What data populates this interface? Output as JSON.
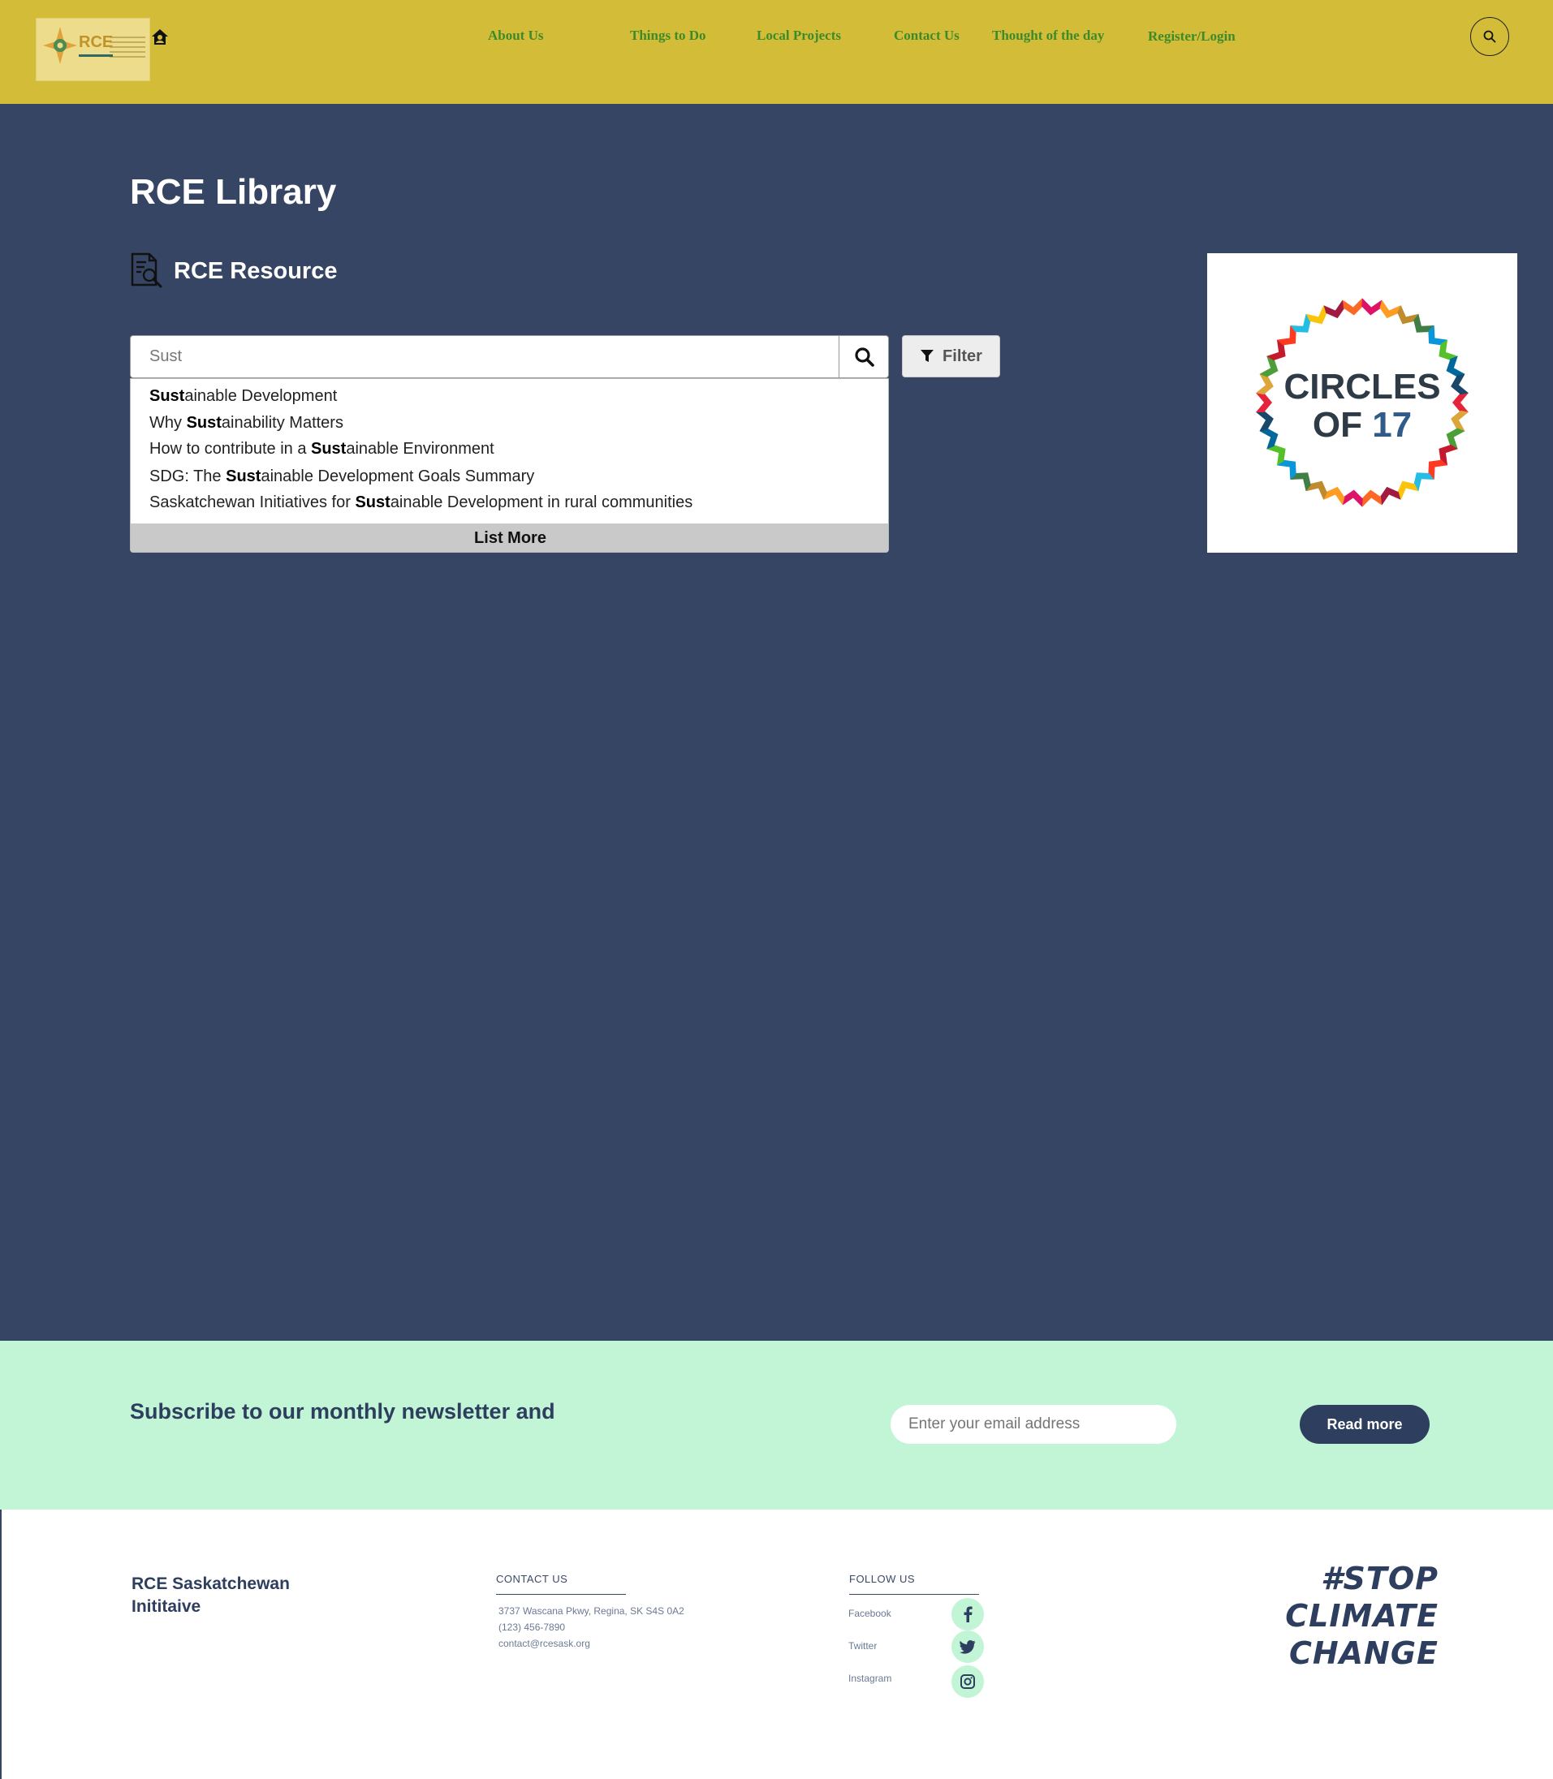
{
  "header": {
    "logo_text": "RCE",
    "nav": [
      {
        "label": "About Us"
      },
      {
        "label": "Things to Do"
      },
      {
        "label": "Local Projects"
      },
      {
        "label": "Contact Us"
      },
      {
        "label": "Thought of the day"
      },
      {
        "label": "Register/Login"
      }
    ],
    "search_icon": "search-icon",
    "home_icon": "home-icon"
  },
  "main": {
    "title": "RCE Library",
    "resource_title": "RCE Resource",
    "search": {
      "value": "Sust",
      "button_icon": "search-icon"
    },
    "filter_label": "Filter",
    "suggestions": [
      {
        "pre": "",
        "match": "Sust",
        "post": "ainable Development"
      },
      {
        "pre": "Why ",
        "match": "Sust",
        "post": "ainability Matters"
      },
      {
        "pre": "How to contribute in a ",
        "match": "Sust",
        "post": "ainable Environment"
      },
      {
        "pre": "SDG: The ",
        "match": "Sust",
        "post": "ainable Development Goals Summary"
      },
      {
        "pre": "Saskatchewan Initiatives for ",
        "match": "Sust",
        "post": "ainable Development in rural communities"
      }
    ],
    "list_more": "List More",
    "circles": {
      "line1": "CIRCLES",
      "line2_a": "OF ",
      "line2_b": "17"
    }
  },
  "newsletter": {
    "title": "Subscribe to our monthly newsletter and",
    "email_placeholder": "Enter your email address",
    "button": "Read more"
  },
  "footer": {
    "org_line1": "RCE Saskatchewan",
    "org_line2": "Inititaive",
    "contact_heading": "CONTACT US",
    "address": "3737 Wascana Pkwy, Regina, SK S4S 0A2",
    "phone": "(123) 456-7890",
    "email": "contact@rcesask.org",
    "follow_heading": "FOLLOW US",
    "social": [
      {
        "label": "Facebook",
        "icon": "facebook-icon"
      },
      {
        "label": "Twitter",
        "icon": "twitter-icon"
      },
      {
        "label": "Instagram",
        "icon": "instagram-icon"
      }
    ],
    "stop_line1": "#STOP",
    "stop_line2": "CLIMATE",
    "stop_line3": "CHANGE"
  },
  "colors": {
    "header_bg": "#d3bd38",
    "nav_text": "#3d8a2b",
    "main_bg": "#364563",
    "newsletter_bg": "#c1f5d6",
    "accent_dark": "#2d3e5e"
  }
}
